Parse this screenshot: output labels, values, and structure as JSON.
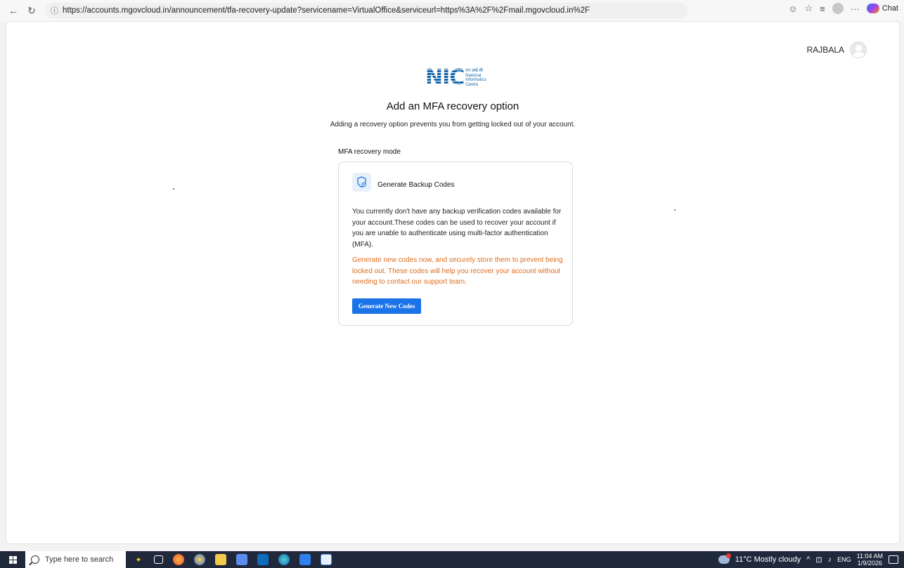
{
  "browser": {
    "back_glyph": "←",
    "refresh_glyph": "↻",
    "url": "https://accounts.mgovcloud.in/announcement/tfa-recovery-update?servicename=VirtualOffice&serviceurl=https%3A%2F%2Fmail.mgovcloud.in%2F",
    "chat_label": "Chat",
    "more_glyph": "···",
    "tracking_glyph": "☺",
    "favorite_glyph": "☆",
    "favorites_glyph": "≡",
    "lock_glyph": "ⓘ"
  },
  "user": {
    "name": "RAJBALA"
  },
  "logo": {
    "mark": "NIC",
    "line1": "एन आई सी",
    "line2": "National",
    "line3": "Informatics",
    "line4": "Centre"
  },
  "main": {
    "title": "Add an MFA recovery option",
    "subtitle": "Adding a recovery option prevents you from getting locked out of your account.",
    "section_label": "MFA recovery mode"
  },
  "card": {
    "icon": "shield-lock-icon",
    "title": "Generate Backup Codes",
    "description": "You currently don't have any backup verification codes available for your account.These codes can be used to recover your account if you are unable to authenticate using multi-factor authentication (MFA).",
    "warning": "Generate new codes now, and securely store them to prevent being locked out. These codes will help you recover your account without needing to contact our support team.",
    "button_label": "Generate New Codes"
  },
  "taskbar": {
    "search_placeholder": "Type here to search",
    "weather": "11°C  Mostly cloudy",
    "language": "ENG",
    "time": "11:04 AM",
    "date": "1/9/2026",
    "tray_up_glyph": "^",
    "network_glyph": "⊡",
    "volume_glyph": "♪"
  },
  "colors": {
    "accent": "#1a73e8",
    "warning_text": "#e06c1c",
    "taskbar": "#20283c"
  }
}
